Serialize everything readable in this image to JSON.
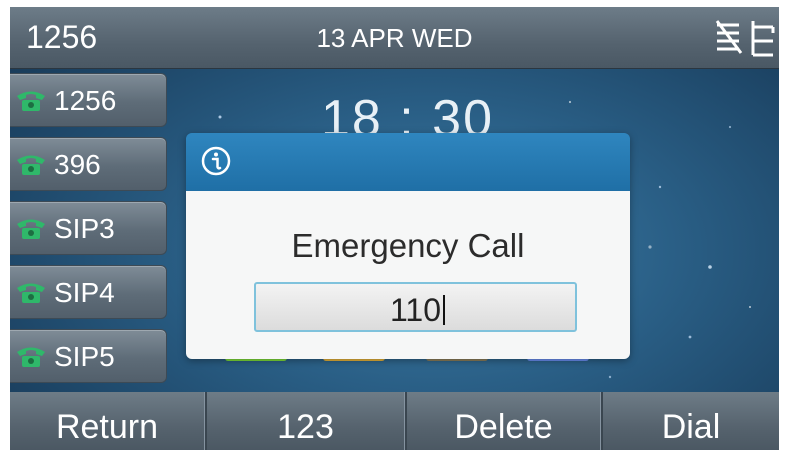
{
  "status_bar": {
    "account": "1256",
    "date": "13 APR WED",
    "icons": [
      "network-unavailable-icon",
      "network-lan-icon"
    ]
  },
  "line_keys": [
    {
      "label": "1256",
      "icon": "phone-icon"
    },
    {
      "label": "396",
      "icon": "phone-icon"
    },
    {
      "label": "SIP3",
      "icon": "phone-icon"
    },
    {
      "label": "SIP4",
      "icon": "phone-icon"
    },
    {
      "label": "SIP5",
      "icon": "phone-icon"
    }
  ],
  "clock": {
    "time": "18 : 30"
  },
  "dialog": {
    "icon": "info-icon",
    "title": "Emergency Call",
    "input_value": "110"
  },
  "softkeys": [
    {
      "label": "Return"
    },
    {
      "label": "123"
    },
    {
      "label": "Delete"
    },
    {
      "label": "Dial"
    }
  ],
  "colors": {
    "dialog_header": "#2477b2",
    "phone_icon": "#2fb86a",
    "slot_colors": [
      "#7ddc3a",
      "#e6b23a",
      "#8b7d5a",
      "#6a8ef0"
    ]
  }
}
